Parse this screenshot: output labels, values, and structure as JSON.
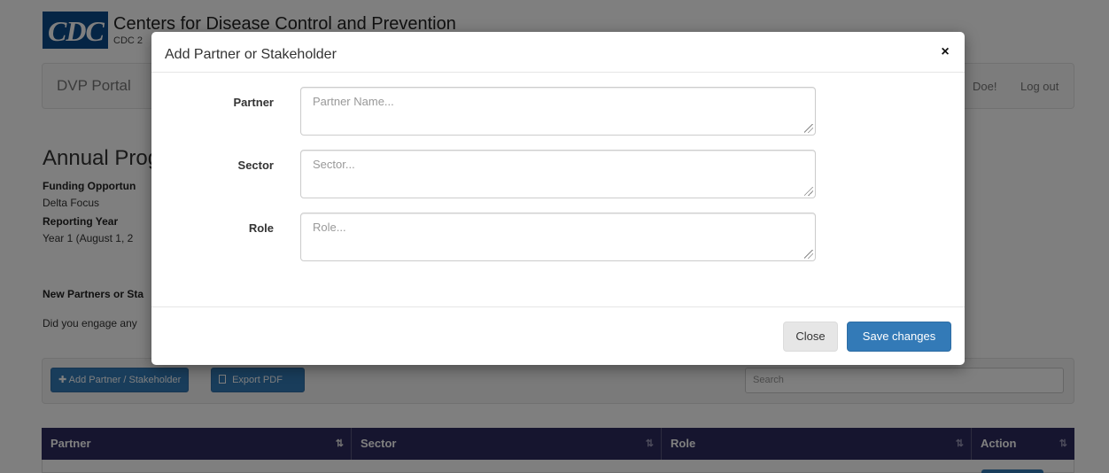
{
  "colors": {
    "primary": "#337ab7",
    "table_header": "#2c2a5e",
    "logo_blue": "#0b4a8b",
    "overlay": "rgba(0,0,0,0.5)"
  },
  "header": {
    "logo_text": "CDC",
    "title": "Centers for Disease Control and Prevention",
    "subtitle": "CDC 2"
  },
  "navbar": {
    "brand": "DVP Portal",
    "greeting": "Doe!",
    "logout": "Log out"
  },
  "page": {
    "heading": "Annual Prog",
    "funding_label": "Funding Opportun",
    "funding_value": "Delta Focus",
    "reporting_label": "Reporting Year",
    "reporting_value": "Year 1 (August 1, 2",
    "section_title": "New Partners or Sta",
    "question": "Did you engage any"
  },
  "toolbar": {
    "add_button": "✚ Add Partner / Stakeholder",
    "export_button": "Export PDF",
    "export_icon": "pdf-file-icon",
    "search_placeholder": "Search"
  },
  "table": {
    "columns": [
      "Partner",
      "Sector",
      "Role",
      "Action"
    ]
  },
  "modal": {
    "title": "Add Partner or Stakeholder",
    "close_symbol": "×",
    "fields": [
      {
        "label": "Partner",
        "placeholder": "Partner Name..."
      },
      {
        "label": "Sector",
        "placeholder": "Sector..."
      },
      {
        "label": "Role",
        "placeholder": "Role..."
      }
    ],
    "close_button": "Close",
    "save_button": "Save changes"
  }
}
